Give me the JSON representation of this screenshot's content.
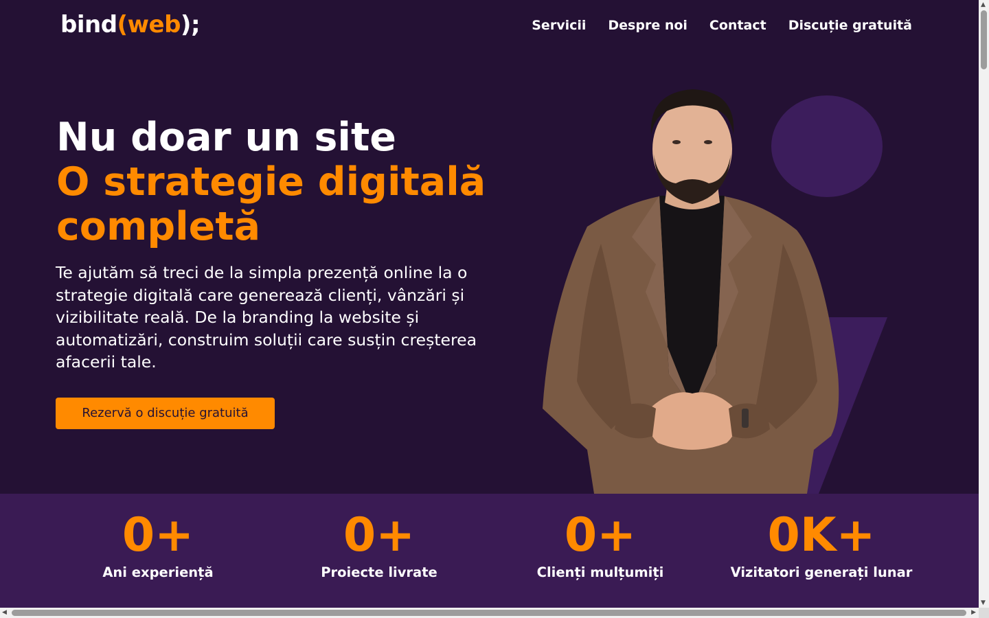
{
  "header": {
    "logo": {
      "word": "bind",
      "paren_open": "(",
      "brand": "web",
      "paren_close": ");"
    },
    "nav": [
      "Servicii",
      "Despre noi",
      "Contact",
      "Discuție gratuită"
    ]
  },
  "hero": {
    "title_line1": "Nu doar un site",
    "title_line2": "O strategie digitală completă",
    "description": "Te ajutăm să treci de la simpla prezență online la o strategie digitală care generează clienți, vânzări și vizibilitate reală. De la branding la website și automatizări, construim soluții care susțin creșterea afacerii tale.",
    "cta_label": "Rezervă o discuție gratuită"
  },
  "stats": [
    {
      "value": "0+",
      "label": "Ani experiență"
    },
    {
      "value": "0+",
      "label": "Proiecte livrate"
    },
    {
      "value": "0+",
      "label": "Clienți mulțumiți"
    },
    {
      "value": "0K+",
      "label": "Vizitatori generați lunar"
    }
  ],
  "colors": {
    "background": "#241134",
    "accent": "#ff8a00",
    "stats_band": "#3a1b54",
    "decor_shape": "#3c1d5c"
  }
}
